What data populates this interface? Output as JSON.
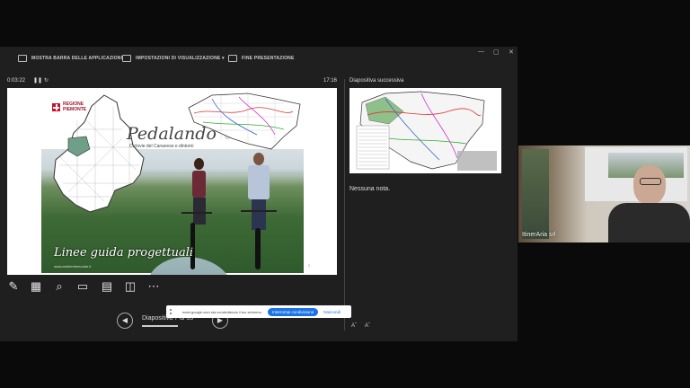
{
  "toolbar": {
    "show_taskbar": "MOSTRA BARRA DELLE APPLICAZIONI",
    "display_settings": "IMPOSTAZIONI DI VISUALIZZAZIONE ▾",
    "end_show": "FINE PRESENTAZIONE"
  },
  "timer": {
    "elapsed": "0:03:22",
    "clock": "17:16"
  },
  "slide": {
    "region_label_1": "REGIONE",
    "region_label_2": "PIEMONTE",
    "title": "Pedalando",
    "subtitle": "Ciclovie del Canavese e dintorni",
    "footer": "Linee guida progettuali",
    "url": "www.ambientemonde.it",
    "page_num": "2"
  },
  "next_slide": {
    "label": "Diapositiva successiva"
  },
  "notes": {
    "text": "Nessuna nota."
  },
  "navigation": {
    "slide_counter": "Diapositiva 7 di 35"
  },
  "share": {
    "message": "meet.google.com sta condividendo il tuo schermo.",
    "stop_button": "Interrompi condivisione",
    "hide_button": "Nascondi"
  },
  "participant": {
    "name": "ItinerAria srl"
  },
  "colors": {
    "accent": "#1a73e8",
    "bg": "#0a0a0a",
    "panel": "#1f1f1f"
  }
}
